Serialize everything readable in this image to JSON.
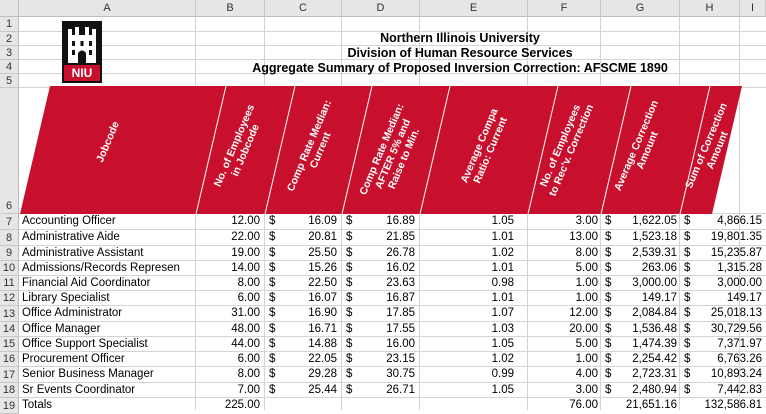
{
  "columns": [
    "",
    "A",
    "B",
    "C",
    "D",
    "E",
    "F",
    "G",
    "H",
    "I"
  ],
  "row_numbers": [
    "1",
    "2",
    "3",
    "4",
    "5",
    "6",
    "7",
    "8",
    "9",
    "10",
    "11",
    "12",
    "13",
    "14",
    "15",
    "16",
    "17",
    "18",
    "19"
  ],
  "logo": {
    "text": "NIU",
    "icon": "niu-castle-logo",
    "color": "#c8102e"
  },
  "titles": {
    "line1": "Northern Illinois University",
    "line2": "Division of Human Resource Services",
    "line3": "Aggregate Summary of Proposed Inversion Correction: AFSCME 1890"
  },
  "header_color": "#c8102e",
  "headers": {
    "jobcode": "Jobcode",
    "employees": [
      "No. of Employees",
      "in Jobcode"
    ],
    "comp_current": [
      "Comp Rate Median:",
      "Current"
    ],
    "comp_after": [
      "Comp Rate Median:",
      "AFTER 5% and",
      "Raise to Min."
    ],
    "compa": [
      "Average Compa",
      "Ratio: Current"
    ],
    "employees_correction": [
      "No. of Employees",
      "to Rec'v. Correction"
    ],
    "avg_correction": [
      "Average Correction",
      "Amount"
    ],
    "sum_correction": [
      "Sum of Correction",
      "Amount"
    ]
  },
  "rows": [
    {
      "jobcode": "Accounting Officer",
      "employees": "12.00",
      "cur_sym": "$",
      "comp_current": "16.09",
      "aft_sym": "$",
      "comp_after": "16.89",
      "compa": "1.05",
      "recv": "3.00",
      "avg_sym": "$",
      "avg": "1,622.05",
      "sum_sym": "$",
      "sum": "4,866.15"
    },
    {
      "jobcode": "Administrative Aide",
      "employees": "22.00",
      "cur_sym": "$",
      "comp_current": "20.81",
      "aft_sym": "$",
      "comp_after": "21.85",
      "compa": "1.01",
      "recv": "13.00",
      "avg_sym": "$",
      "avg": "1,523.18",
      "sum_sym": "$",
      "sum": "19,801.35"
    },
    {
      "jobcode": "Administrative Assistant",
      "employees": "19.00",
      "cur_sym": "$",
      "comp_current": "25.50",
      "aft_sym": "$",
      "comp_after": "26.78",
      "compa": "1.02",
      "recv": "8.00",
      "avg_sym": "$",
      "avg": "2,539.31",
      "sum_sym": "$",
      "sum": "15,235.87"
    },
    {
      "jobcode": "Admissions/Records Represen",
      "employees": "14.00",
      "cur_sym": "$",
      "comp_current": "15.26",
      "aft_sym": "$",
      "comp_after": "16.02",
      "compa": "1.01",
      "recv": "5.00",
      "avg_sym": "$",
      "avg": "263.06",
      "sum_sym": "$",
      "sum": "1,315.28"
    },
    {
      "jobcode": "Financial Aid Coordinator",
      "employees": "8.00",
      "cur_sym": "$",
      "comp_current": "22.50",
      "aft_sym": "$",
      "comp_after": "23.63",
      "compa": "0.98",
      "recv": "1.00",
      "avg_sym": "$",
      "avg": "3,000.00",
      "sum_sym": "$",
      "sum": "3,000.00"
    },
    {
      "jobcode": "Library Specialist",
      "employees": "6.00",
      "cur_sym": "$",
      "comp_current": "16.07",
      "aft_sym": "$",
      "comp_after": "16.87",
      "compa": "1.01",
      "recv": "1.00",
      "avg_sym": "$",
      "avg": "149.17",
      "sum_sym": "$",
      "sum": "149.17"
    },
    {
      "jobcode": "Office Administrator",
      "employees": "31.00",
      "cur_sym": "$",
      "comp_current": "16.90",
      "aft_sym": "$",
      "comp_after": "17.85",
      "compa": "1.07",
      "recv": "12.00",
      "avg_sym": "$",
      "avg": "2,084.84",
      "sum_sym": "$",
      "sum": "25,018.13"
    },
    {
      "jobcode": "Office Manager",
      "employees": "48.00",
      "cur_sym": "$",
      "comp_current": "16.71",
      "aft_sym": "$",
      "comp_after": "17.55",
      "compa": "1.03",
      "recv": "20.00",
      "avg_sym": "$",
      "avg": "1,536.48",
      "sum_sym": "$",
      "sum": "30,729.56"
    },
    {
      "jobcode": "Office Support Specialist",
      "employees": "44.00",
      "cur_sym": "$",
      "comp_current": "14.88",
      "aft_sym": "$",
      "comp_after": "16.00",
      "compa": "1.05",
      "recv": "5.00",
      "avg_sym": "$",
      "avg": "1,474.39",
      "sum_sym": "$",
      "sum": "7,371.97"
    },
    {
      "jobcode": "Procurement Officer",
      "employees": "6.00",
      "cur_sym": "$",
      "comp_current": "22.05",
      "aft_sym": "$",
      "comp_after": "23.15",
      "compa": "1.02",
      "recv": "1.00",
      "avg_sym": "$",
      "avg": "2,254.42",
      "sum_sym": "$",
      "sum": "6,763.26"
    },
    {
      "jobcode": "Senior Business Manager",
      "employees": "8.00",
      "cur_sym": "$",
      "comp_current": "29.28",
      "aft_sym": "$",
      "comp_after": "30.75",
      "compa": "0.99",
      "recv": "4.00",
      "avg_sym": "$",
      "avg": "2,723.31",
      "sum_sym": "$",
      "sum": "10,893.24"
    },
    {
      "jobcode": "Sr Events Coordinator",
      "employees": "7.00",
      "cur_sym": "$",
      "comp_current": "25.44",
      "aft_sym": "$",
      "comp_after": "26.71",
      "compa": "1.05",
      "recv": "3.00",
      "avg_sym": "$",
      "avg": "2,480.94",
      "sum_sym": "$",
      "sum": "7,442.83"
    }
  ],
  "totals": {
    "label": "Totals",
    "employees": "225.00",
    "recv": "76.00",
    "avg": "21,651.16",
    "sum": "132,586.81"
  }
}
